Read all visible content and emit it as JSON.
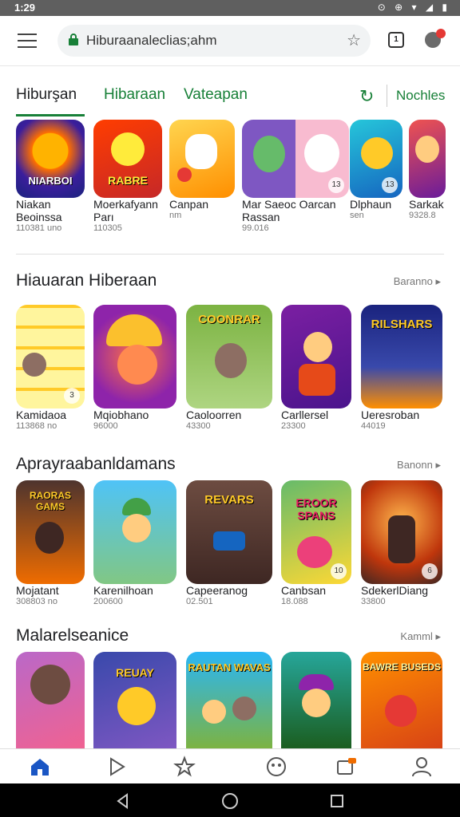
{
  "status": {
    "time": "1:29",
    "icons": "⊙ ⊕ ▾ ◢ ▮"
  },
  "browser": {
    "url": "Hiburaanaleclias;ahm",
    "tab_count": "1"
  },
  "tabs": [
    {
      "label": "Hiburşan"
    },
    {
      "label": "Hibaraan"
    },
    {
      "label": "Vateapan"
    }
  ],
  "tab_right": "Nochles",
  "top_row": [
    {
      "name": "Niakan",
      "sub": "Beoinssa",
      "meta": "110381 uno",
      "icon_text": "NIARBOI"
    },
    {
      "name": "Moerkafyann",
      "sub": "Parı",
      "meta": "110305",
      "icon_text": "RABRE"
    },
    {
      "name": "Canpan",
      "sub": "",
      "meta": "nm",
      "icon_text": ""
    },
    {
      "name": "Mar Saeoc Oarcan",
      "sub": "Rassan",
      "meta": "99.016",
      "icon_text": ""
    },
    {
      "name": "Dlphaun",
      "sub": "",
      "meta": "sen",
      "icon_text": ""
    },
    {
      "name": "Sarkak",
      "sub": "",
      "meta": "9328.8",
      "icon_text": ""
    }
  ],
  "sections": [
    {
      "title": "Hiauaran Hiberaan",
      "more": "Baranno ▸",
      "apps": [
        {
          "name": "Kamidaoa",
          "meta": "113868 no",
          "icon_text": ""
        },
        {
          "name": "Mqiobhano",
          "meta": "96000",
          "icon_text": ""
        },
        {
          "name": "Caoloorren",
          "meta": "43300",
          "icon_text": "COONRAR"
        },
        {
          "name": "Carllersel",
          "meta": "23300",
          "icon_text": ""
        },
        {
          "name": "Ueresroban",
          "meta": "44019",
          "icon_text": "RILSHARS"
        }
      ]
    },
    {
      "title": "Aprayraabanldamans",
      "more": "Banonn ▸",
      "apps": [
        {
          "name": "Mojatant",
          "meta": "308803 no",
          "icon_text": "RAORAS GAMS"
        },
        {
          "name": "Karenilhoan",
          "meta": "200600",
          "icon_text": ""
        },
        {
          "name": "Capeeranog",
          "meta": "02.501",
          "icon_text": "REVARS"
        },
        {
          "name": "Canbsan",
          "meta": "18.088",
          "icon_text": "EROOR SPANS"
        },
        {
          "name": "SdekerlDiang",
          "meta": "33800",
          "icon_text": ""
        }
      ]
    },
    {
      "title": "Malarelseanice",
      "more": "Kamml ▸",
      "apps": [
        {
          "name": "",
          "meta": "",
          "icon_text": ""
        },
        {
          "name": "",
          "meta": "",
          "icon_text": "REUAY"
        },
        {
          "name": "",
          "meta": "",
          "icon_text": "RAUTAN WAVAS"
        },
        {
          "name": "",
          "meta": "",
          "icon_text": ""
        },
        {
          "name": "",
          "meta": "",
          "icon_text": "BAWRE BUSEDS"
        }
      ]
    }
  ],
  "colors": {
    "accent": "#188038",
    "status_bg": "#5f5f5f",
    "nav_active": "#1a56c4"
  }
}
